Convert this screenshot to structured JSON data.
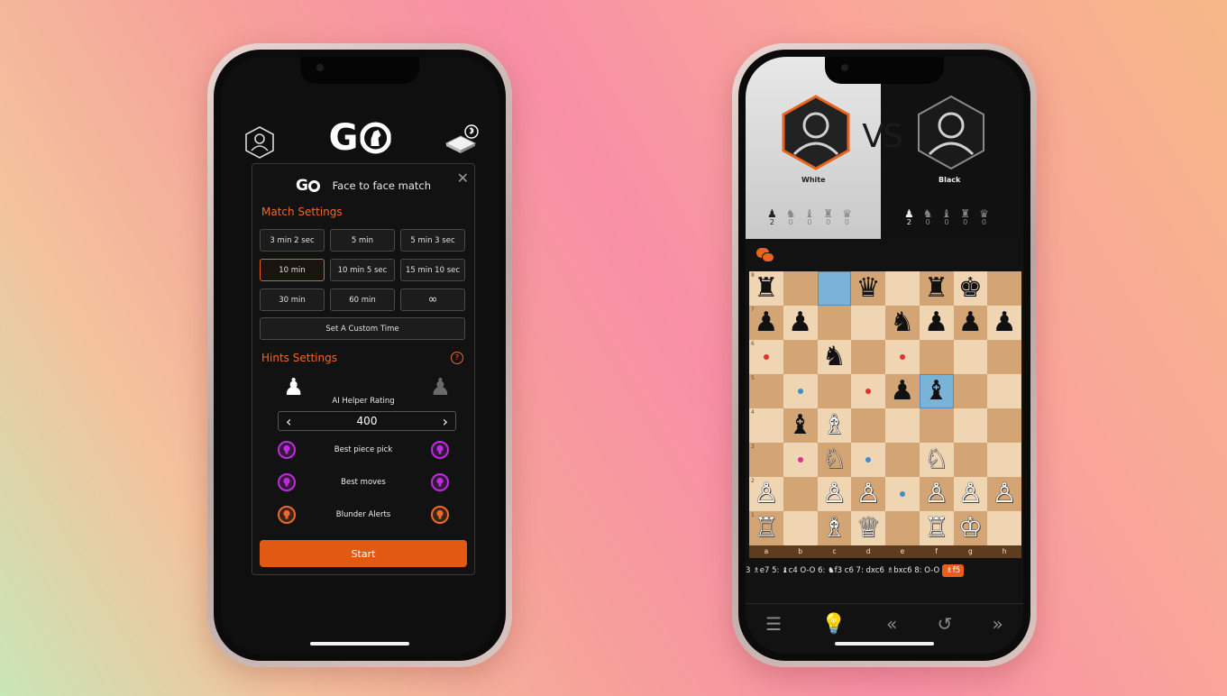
{
  "left_phone": {
    "logo": "G",
    "modal": {
      "title": "Face to face match",
      "close": "✕",
      "match_settings_label": "Match Settings",
      "time_options": [
        {
          "label": "3 min 2 sec",
          "selected": false
        },
        {
          "label": "5 min",
          "selected": false
        },
        {
          "label": "5 min 3 sec",
          "selected": false
        },
        {
          "label": "10 min",
          "selected": true
        },
        {
          "label": "10 min 5 sec",
          "selected": false
        },
        {
          "label": "15 min 10 sec",
          "selected": false
        },
        {
          "label": "30 min",
          "selected": false
        },
        {
          "label": "60 min",
          "selected": false
        },
        {
          "label": "∞",
          "selected": false
        }
      ],
      "custom_time_label": "Set A Custom Time",
      "hints_settings_label": "Hints Settings",
      "ai_helper_label": "AI Helper Rating",
      "ai_rating": "400",
      "hints": [
        {
          "label": "Best piece pick",
          "color": "#c02be0"
        },
        {
          "label": "Best moves",
          "color": "#c02be0"
        },
        {
          "label": "Blunder Alerts",
          "color": "#ec6a2a"
        }
      ],
      "start_label": "Start"
    }
  },
  "right_phone": {
    "vs_label": "VS",
    "white": {
      "name": "White",
      "captures": [
        "2",
        "0",
        "0",
        "0",
        "0"
      ]
    },
    "black": {
      "name": "Black",
      "captures": [
        "2",
        "0",
        "0",
        "0",
        "0"
      ]
    },
    "board": [
      [
        "♜",
        "",
        "",
        "♛",
        "",
        "♜",
        "♚",
        ""
      ],
      [
        "♟",
        "♟",
        "",
        "",
        "♞",
        "♟",
        "♟",
        "♟"
      ],
      [
        "",
        "",
        "♞",
        "",
        "",
        "",
        "",
        ""
      ],
      [
        "",
        "",
        "",
        "",
        "♟",
        "♝",
        "",
        ""
      ],
      [
        "",
        "♝",
        "♗",
        "",
        "",
        "",
        "",
        ""
      ],
      [
        "",
        "",
        "♘",
        "",
        "",
        "♘",
        "",
        ""
      ],
      [
        "♙",
        "",
        "♙",
        "♙",
        "",
        "♙",
        "♙",
        "♙"
      ],
      [
        "♖",
        "",
        "♗",
        "♕",
        "",
        "♖",
        "♔",
        ""
      ]
    ],
    "ranks": [
      "8",
      "7",
      "6",
      "5",
      "4",
      "3",
      "2",
      "1"
    ],
    "files": [
      "a",
      "b",
      "c",
      "d",
      "e",
      "f",
      "g",
      "h"
    ],
    "moves": {
      "text": "3 ♗e7  5: ♝c4  O-O  6: ♞f3  c6  7: dxc6  ♗bxc6  8: O-O",
      "current": "♗f5"
    }
  }
}
